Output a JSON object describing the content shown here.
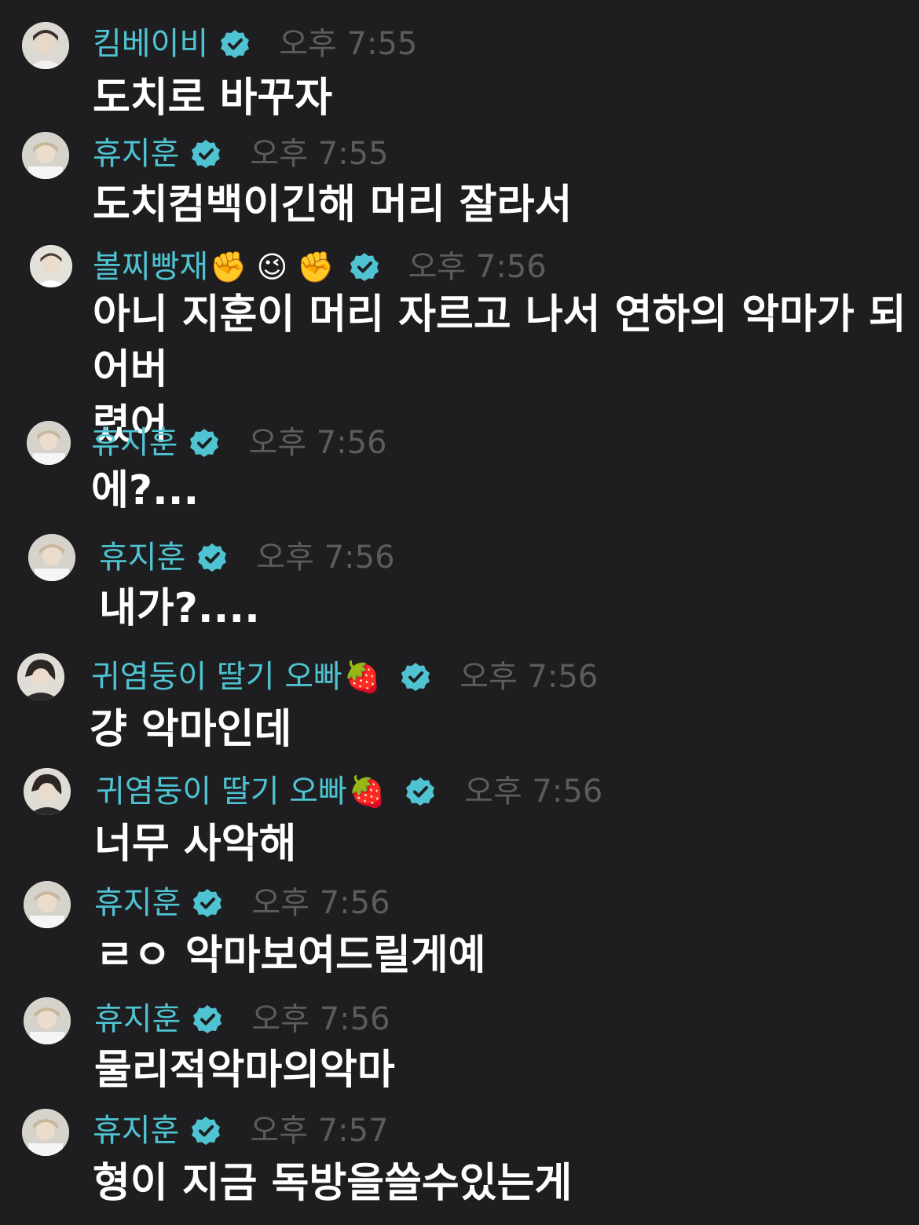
{
  "colors": {
    "background": "#1e1e20",
    "name": "#4fc3d1",
    "time": "#5c5c5f",
    "text": "#ffffff",
    "badge": "#4fc3d1"
  },
  "messages": [
    {
      "author": "킴베이비",
      "verified": true,
      "time": "오후 7:55",
      "text": "도치로 바꾸자",
      "avatar": "avatar-icon"
    },
    {
      "author": "휴지훈",
      "verified": true,
      "time": "오후 7:55",
      "text": "도치컴백이긴해 머리 잘라서",
      "avatar": "avatar-icon"
    },
    {
      "author": "볼찌빵재",
      "emojis": "✊ 😉 ✊",
      "verified": true,
      "time": "오후 7:56",
      "text": "아니 지훈이 머리 자르고 나서 연하의 악마가 되어버\n렸어",
      "avatar": "avatar-icon"
    },
    {
      "author": "휴지훈",
      "verified": true,
      "time": "오후 7:56",
      "text": "에?...",
      "avatar": "avatar-icon"
    },
    {
      "author": "휴지훈",
      "verified": true,
      "time": "오후 7:56",
      "text": "내가?....",
      "avatar": "avatar-icon"
    },
    {
      "author": "귀염둥이 딸기 오빠",
      "emojis": "🍓",
      "verified": true,
      "time": "오후 7:56",
      "text": "걍 악마인데",
      "avatar": "avatar-icon"
    },
    {
      "author": "귀염둥이 딸기 오빠",
      "emojis": "🍓",
      "verified": true,
      "time": "오후 7:56",
      "text": "너무 사악해",
      "avatar": "avatar-icon"
    },
    {
      "author": "휴지훈",
      "verified": true,
      "time": "오후 7:56",
      "text": "ㄹㅇ 악마보여드릴게예",
      "avatar": "avatar-icon"
    },
    {
      "author": "휴지훈",
      "verified": true,
      "time": "오후 7:56",
      "text": "물리적악마의악마",
      "avatar": "avatar-icon"
    },
    {
      "author": "휴지훈",
      "verified": true,
      "time": "오후 7:57",
      "text": "형이 지금 독방을쓸수있는게",
      "avatar": "avatar-icon"
    }
  ]
}
